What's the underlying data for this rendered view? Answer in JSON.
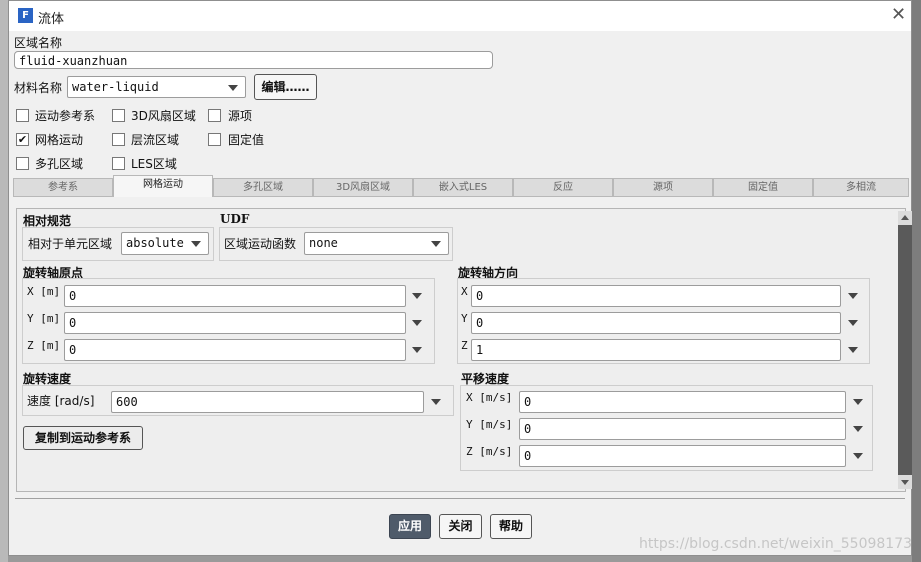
{
  "window": {
    "title": "流体",
    "icon_letter": "F"
  },
  "zone": {
    "name_label": "区域名称",
    "name_value": "fluid-xuanzhuan"
  },
  "material": {
    "label": "材料名称",
    "value": "water-liquid",
    "edit_button": "编辑……"
  },
  "checkboxes": [
    {
      "label": "运动参考系",
      "checked": false
    },
    {
      "label": "3D风扇区域",
      "checked": false
    },
    {
      "label": "源项",
      "checked": false
    },
    {
      "label": "网格运动",
      "checked": true
    },
    {
      "label": "层流区域",
      "checked": false
    },
    {
      "label": "固定值",
      "checked": false
    },
    {
      "label": "多孔区域",
      "checked": false
    },
    {
      "label": "LES区域",
      "checked": false
    }
  ],
  "tabs": [
    {
      "label": "参考系",
      "active": false
    },
    {
      "label": "网格运动",
      "active": true
    },
    {
      "label": "多孔区域",
      "active": false
    },
    {
      "label": "3D风扇区域",
      "active": false
    },
    {
      "label": "嵌入式LES",
      "active": false
    },
    {
      "label": "反应",
      "active": false
    },
    {
      "label": "源项",
      "active": false
    },
    {
      "label": "固定值",
      "active": false
    },
    {
      "label": "多相流",
      "active": false
    }
  ],
  "relative": {
    "title": "相对规范",
    "label": "相对于单元区域",
    "value": "absolute"
  },
  "udf": {
    "title": "UDF",
    "label": "区域运动函数",
    "value": "none"
  },
  "origin": {
    "title": "旋转轴原点",
    "rows": [
      {
        "label": "X [m]",
        "value": "0"
      },
      {
        "label": "Y [m]",
        "value": "0"
      },
      {
        "label": "Z [m]",
        "value": "0"
      }
    ]
  },
  "direction": {
    "title": "旋转轴方向",
    "rows": [
      {
        "label": "X",
        "value": "0"
      },
      {
        "label": "Y",
        "value": "0"
      },
      {
        "label": "Z",
        "value": "1"
      }
    ]
  },
  "rotation": {
    "title": "旋转速度",
    "label": "速度 [rad/s]",
    "value": "600"
  },
  "copy_button": "复制到运动参考系",
  "translation": {
    "title": "平移速度",
    "rows": [
      {
        "label": "X [m/s]",
        "value": "0"
      },
      {
        "label": "Y [m/s]",
        "value": "0"
      },
      {
        "label": "Z [m/s]",
        "value": "0"
      }
    ]
  },
  "footer": {
    "apply": "应用",
    "close": "关闭",
    "help": "帮助"
  },
  "watermark": "https://blog.csdn.net/weixin_55098173",
  "colors": {
    "apply_bg": "#4f5b6a",
    "scroll_track": "#5a5a5a",
    "icon_bg": "#2a64c4"
  }
}
